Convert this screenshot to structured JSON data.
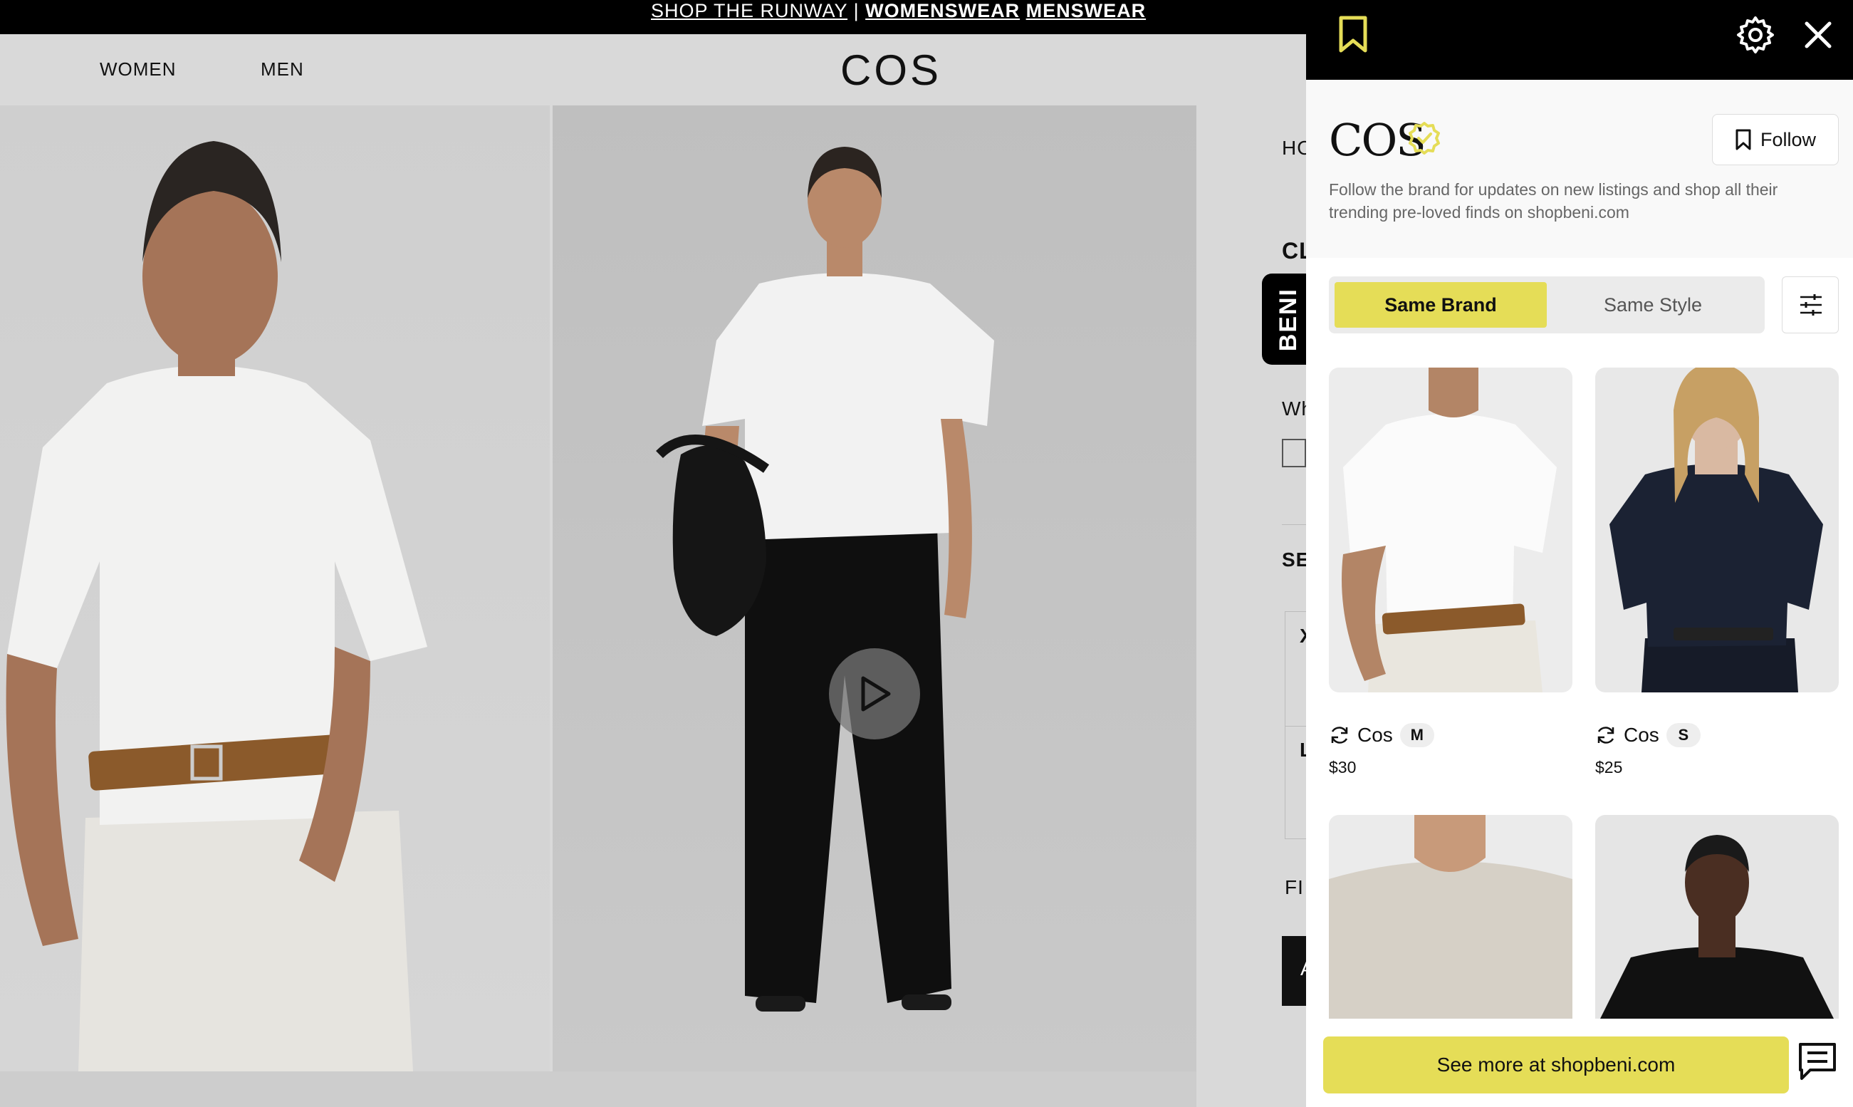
{
  "promo": {
    "prefix": "SHOP THE RUNWAY",
    "separator": "|",
    "womenswear": "WOMENSWEAR",
    "menswear": "MENSWEAR"
  },
  "header": {
    "nav": [
      "WOMEN",
      "MEN"
    ],
    "logo": "COS"
  },
  "product_info_partial": {
    "breadcrumb": "HO",
    "title": "CL",
    "color_label": "Wh",
    "section": "SE",
    "size_row_1": "X",
    "size_row_2": "L",
    "find_label": "FI",
    "add_label": "A"
  },
  "beni_tab": "BENI",
  "panel": {
    "brand_name": "COS",
    "verified_icon": "verified-badge-icon",
    "follow_label": "Follow",
    "description": "Follow the brand for updates on new listings and shop all their trending pre-loved finds on shopbeni.com",
    "tabs": [
      {
        "label": "Same Brand",
        "active": true
      },
      {
        "label": "Same Style",
        "active": false
      }
    ],
    "products": [
      {
        "brand": "Cos",
        "size": "M",
        "price": "$30",
        "image": "white-tshirt-model"
      },
      {
        "brand": "Cos",
        "size": "S",
        "price": "$25",
        "image": "navy-tshirt-model"
      },
      {
        "brand": "",
        "size": "",
        "price": "",
        "image": "beige-tshirt-model"
      },
      {
        "brand": "",
        "size": "",
        "price": "",
        "image": "black-tshirt-model"
      }
    ],
    "see_more_label": "See more at shopbeni.com"
  },
  "colors": {
    "accent_yellow": "#e5dd57",
    "panel_header": "#000000",
    "page_bg": "#d9d9d9"
  }
}
